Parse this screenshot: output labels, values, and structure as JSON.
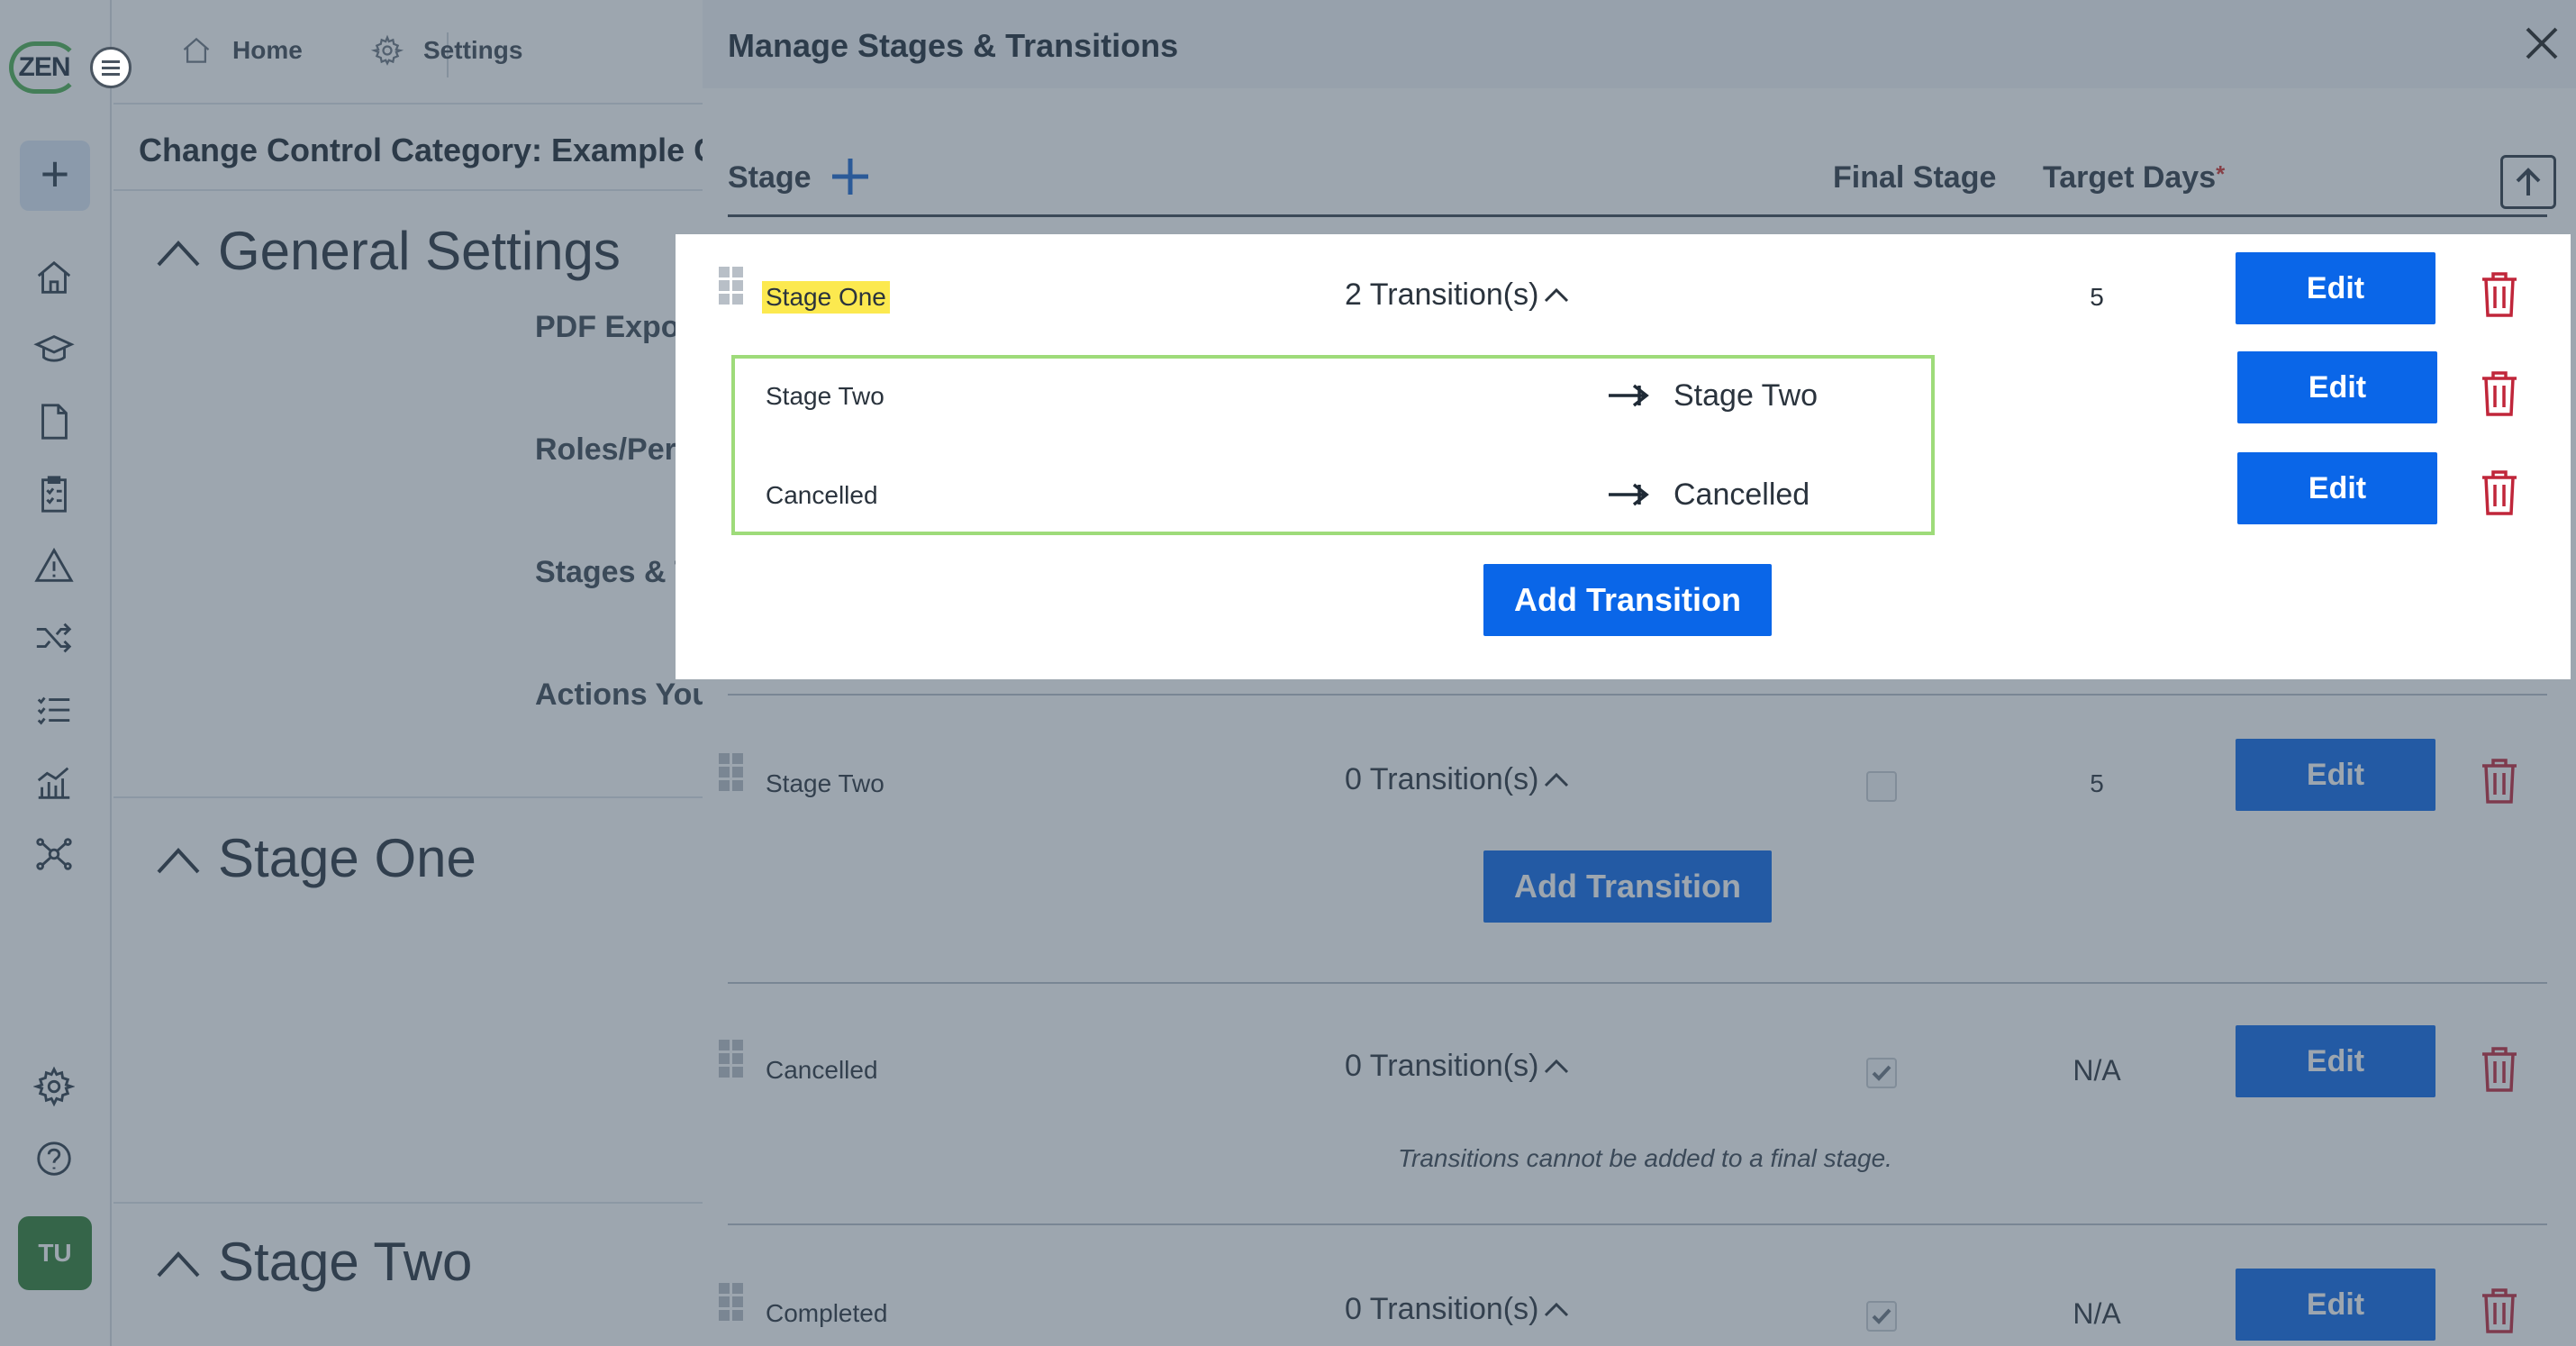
{
  "app": {
    "logo_text": "ZEN",
    "avatar_initials": "TU"
  },
  "breadcrumb": {
    "home": "Home",
    "settings": "Settings"
  },
  "page": {
    "title": "Change Control Category: Example Cha",
    "sections": {
      "general": "General Settings",
      "stage_one": "Stage One",
      "stage_two": "Stage Two"
    },
    "settings_labels": [
      "PDF Export (",
      "Roles/Permi",
      "Stages & Tra",
      "Actions You"
    ]
  },
  "drawer": {
    "title": "Manage Stages & Transitions",
    "columns": {
      "stage": "Stage",
      "final_stage": "Final Stage",
      "target_days": "Target Days",
      "required_mark": "*"
    },
    "stages": [
      {
        "name": "Stage One",
        "transitions_label": "2 Transition(s)",
        "target_days": "5",
        "edit_label": "Edit",
        "transitions": [
          {
            "from": "Stage Two",
            "to": "Stage Two",
            "edit_label": "Edit"
          },
          {
            "from": "Cancelled",
            "to": "Cancelled",
            "edit_label": "Edit"
          }
        ],
        "add_transition_label": "Add Transition"
      },
      {
        "name": "Stage Two",
        "transitions_label": "0 Transition(s)",
        "final": false,
        "target_days": "5",
        "edit_label": "Edit",
        "add_transition_label": "Add Transition"
      },
      {
        "name": "Cancelled",
        "transitions_label": "0 Transition(s)",
        "final": true,
        "target_days": "N/A",
        "edit_label": "Edit",
        "note": "Transitions cannot be added to a final stage."
      },
      {
        "name": "Completed",
        "transitions_label": "0 Transition(s)",
        "final": true,
        "target_days": "N/A",
        "edit_label": "Edit"
      }
    ]
  },
  "colors": {
    "primary": "#0a66e8",
    "danger": "#c0263a",
    "highlight": "#fce94f",
    "focus_border": "#9edb7a"
  }
}
